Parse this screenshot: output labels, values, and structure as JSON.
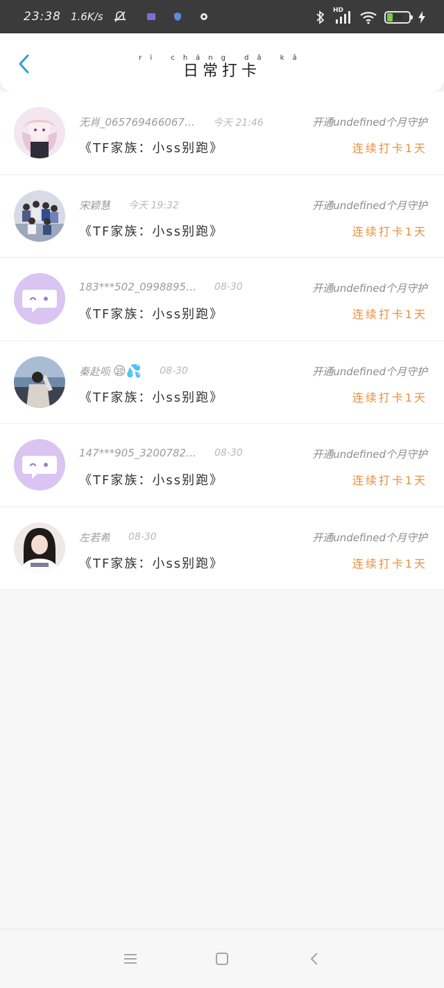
{
  "status_bar": {
    "time": "23:38",
    "net_speed": "1.6K/s",
    "battery_level": "26",
    "battery_fraction": 0.26,
    "icons": [
      "mute-bell-icon",
      "app-notification-icon",
      "shield-notification-icon",
      "round-notification-icon",
      "bluetooth-icon",
      "hd-signal-icon",
      "wifi-icon",
      "battery-icon",
      "charging-icon"
    ],
    "signal_label": "HD"
  },
  "header": {
    "title": "日常打卡",
    "title_pinyin": "rì cháng dǎ kǎ",
    "back_icon": "chevron-left-icon",
    "accent_color": "#2d9cdb"
  },
  "rows": [
    {
      "name": "无肖_06576946606​7…",
      "time": "今天 21:46",
      "desc": "《TF家族：小ss别跑》",
      "guard": "开通undefined个月守护",
      "streak": "连续打卡1天",
      "avatar": "anime-girl-avatar"
    },
    {
      "name": "宋颖慧",
      "time": "今天 19:32",
      "desc": "《TF家族：小ss别跑》",
      "guard": "开通undefined个月守护",
      "streak": "连续打卡1天",
      "avatar": "group-photo-avatar"
    },
    {
      "name": "183***502_0998895…",
      "time": "08-30",
      "desc": "《TF家族：小ss别跑》",
      "guard": "开通undefined个月守护",
      "streak": "连续打卡1天",
      "avatar": "default-chat-avatar"
    },
    {
      "name": "秦赴呗",
      "emoji": "😪💦",
      "time": "08-30",
      "desc": "《TF家族：小ss别跑》",
      "guard": "开通undefined个月守护",
      "streak": "连续打卡1天",
      "avatar": "beach-photo-avatar"
    },
    {
      "name": "147***905_3200782…",
      "time": "08-30",
      "desc": "《TF家族：小ss别跑》",
      "guard": "开通undefined个月守护",
      "streak": "连续打卡1天",
      "avatar": "default-chat-avatar"
    },
    {
      "name": "左若希",
      "time": "08-30",
      "desc": "《TF家族：小ss别跑》",
      "guard": "开通undefined个月守护",
      "streak": "连续打卡1天",
      "avatar": "girl-photo-avatar"
    }
  ],
  "nav_bar": {
    "icons": [
      "menu-icon",
      "home-square-icon",
      "back-triangle-icon"
    ]
  },
  "colors": {
    "streak": "#ef8e3b",
    "default_avatar_bg": "#d9c4f2"
  }
}
